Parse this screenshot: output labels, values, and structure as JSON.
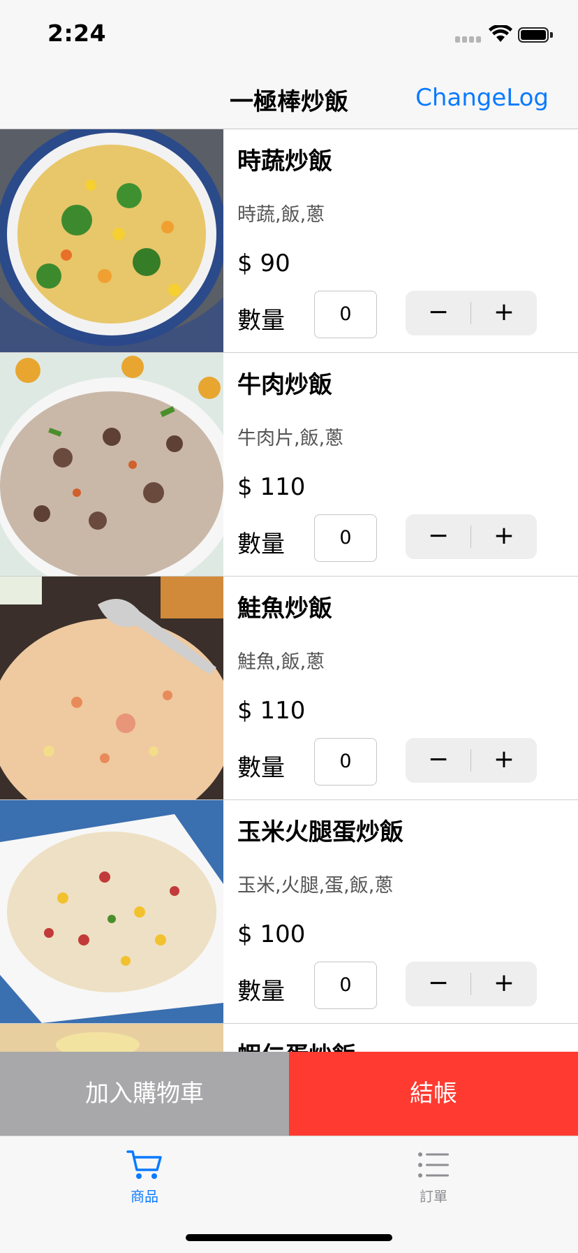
{
  "status_bar": {
    "time": "2:24"
  },
  "nav": {
    "title": "一極棒炒飯",
    "right_button": "ChangeLog"
  },
  "products": [
    {
      "name": "時蔬炒飯",
      "ingredients": "時蔬,飯,蔥",
      "price": "$ 90",
      "qty_label": "數量",
      "qty": "0"
    },
    {
      "name": "牛肉炒飯",
      "ingredients": "牛肉片,飯,蔥",
      "price": "$ 110",
      "qty_label": "數量",
      "qty": "0"
    },
    {
      "name": "鮭魚炒飯",
      "ingredients": "鮭魚,飯,蔥",
      "price": "$ 110",
      "qty_label": "數量",
      "qty": "0"
    },
    {
      "name": "玉米火腿蛋炒飯",
      "ingredients": "玉米,火腿,蛋,飯,蔥",
      "price": "$ 100",
      "qty_label": "數量",
      "qty": "0"
    },
    {
      "name": "蝦仁蛋炒飯"
    }
  ],
  "stepper": {
    "minus": "−",
    "plus": "+"
  },
  "actions": {
    "add_to_cart": "加入購物車",
    "checkout": "結帳"
  },
  "tabs": [
    {
      "label": "商品",
      "icon": "cart-icon",
      "selected": true
    },
    {
      "label": "訂單",
      "icon": "list-icon",
      "selected": false
    }
  ],
  "colors": {
    "accent": "#0a7aff",
    "checkout": "#ff3a30",
    "cart_button": "#a8a8aa"
  }
}
